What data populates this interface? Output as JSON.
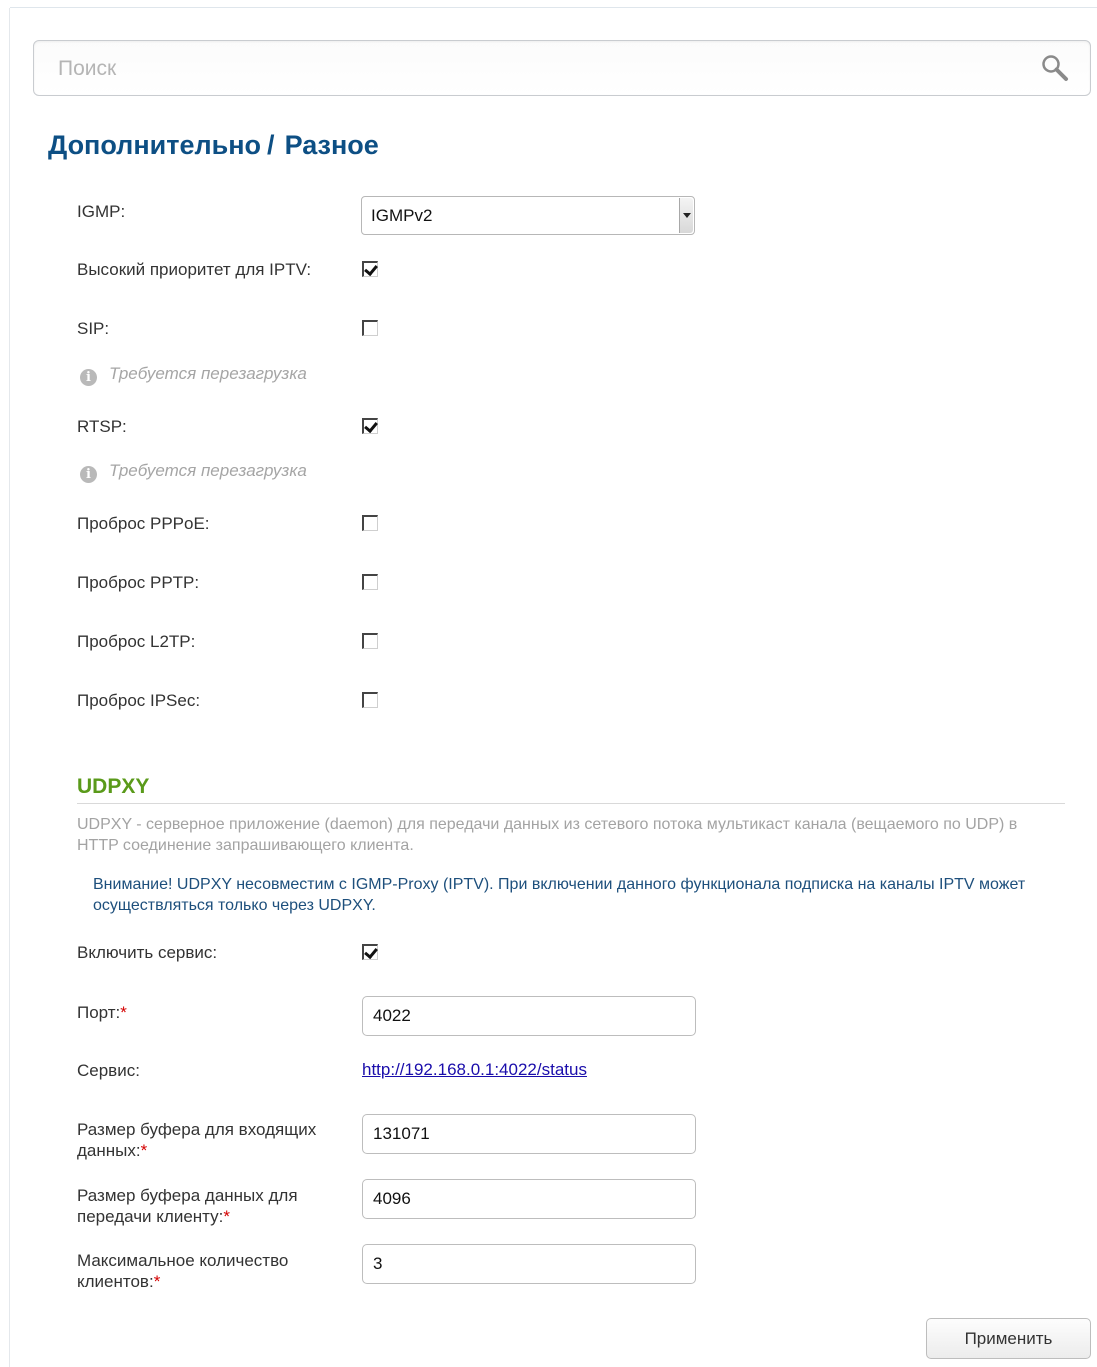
{
  "search": {
    "placeholder": "Поиск"
  },
  "title": {
    "section": "Дополнительно",
    "separator": "/",
    "page": "Разное"
  },
  "igmp": {
    "label": "IGMP:",
    "value": "IGMPv2"
  },
  "options": {
    "iptv_priority": {
      "label": "Высокий приоритет для IPTV:",
      "checked": true
    },
    "sip": {
      "label": "SIP:",
      "checked": false,
      "hint": "Требуется перезагрузка"
    },
    "rtsp": {
      "label": "RTSP:",
      "checked": true,
      "hint": "Требуется перезагрузка"
    },
    "pppoe": {
      "label": "Проброс PPPoE:",
      "checked": false
    },
    "pptp": {
      "label": "Проброс PPTP:",
      "checked": false
    },
    "l2tp": {
      "label": "Проброс L2TP:",
      "checked": false
    },
    "ipsec": {
      "label": "Проброс IPSec:",
      "checked": false
    }
  },
  "udpxy": {
    "title": "UDPXY",
    "description": "UDPXY - серверное приложение (daemon) для передачи данных из сетевого потока мультикаст канала (вещаемого по UDP) в HTTP соединение запрашивающего клиента.",
    "warning": "Внимание! UDPXY несовместим с IGMP-Proxy (IPTV). При включении данного функционала подписка на каналы IPTV может осуществляться только через UDPXY.",
    "enable": {
      "label": "Включить сервис:",
      "checked": true
    },
    "port": {
      "label": "Порт:",
      "value": "4022"
    },
    "service": {
      "label": "Сервис:",
      "link": "http://192.168.0.1:4022/status"
    },
    "in_buffer": {
      "label": "Размер буфера для входящих данных:",
      "value": "131071"
    },
    "out_buffer": {
      "label": "Размер буфера данных для передачи клиенту:",
      "value": "4096"
    },
    "max_clients": {
      "label": "Максимальное количество клиентов:",
      "value": "3"
    },
    "required_mark": "*"
  },
  "apply_button": "Применить",
  "colors": {
    "title": "#0d4f84",
    "section_title": "#5a9a1a",
    "warning": "#1d4f7c",
    "link": "#1a0dab",
    "required": "#d40000"
  },
  "icons": {
    "search": "magnifier-icon",
    "hint": "info-icon"
  }
}
